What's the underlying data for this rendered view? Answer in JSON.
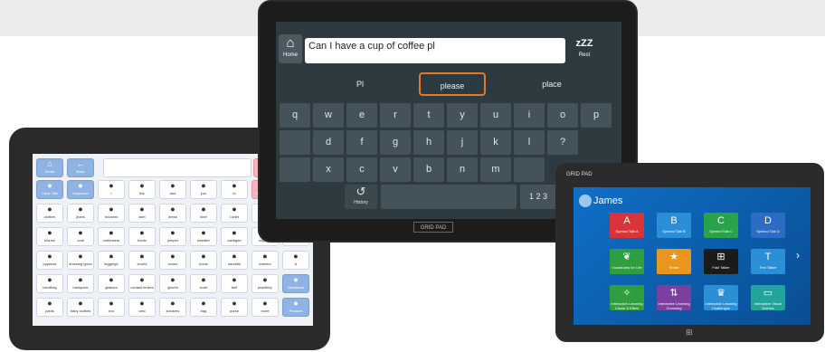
{
  "center": {
    "home_label": "Home",
    "message_text": "Can I have a cup of coffee pl",
    "rest_icon": "zZZ",
    "rest_label": "Rest",
    "predictions": [
      "Pl",
      "please",
      "place"
    ],
    "selected_prediction_index": 1,
    "keys_row1": [
      "q",
      "w",
      "e",
      "r",
      "t",
      "y",
      "u",
      "i",
      "o",
      "p"
    ],
    "keys_row2": [
      "",
      "d",
      "f",
      "g",
      "h",
      "j",
      "k",
      "l",
      "?"
    ],
    "keys_row3": [
      "",
      "x",
      "c",
      "v",
      "b",
      "n",
      "m",
      ""
    ],
    "bottom_history_label": "History",
    "bottom_numbers": "1 2 3",
    "brand": "GRID PAD",
    "colors": {
      "accent": "#e07a2a"
    }
  },
  "left": {
    "top_buttons": [
      {
        "label": "Home",
        "icon": "home-icon",
        "color": "blue"
      },
      {
        "label": "Back",
        "icon": "back-icon",
        "color": "blue"
      }
    ],
    "right_buttons": [
      {
        "label": "Speak",
        "icon": "speak-icon",
        "color": "pink"
      },
      {
        "label": "Clear",
        "icon": "clear-icon",
        "color": "pink"
      }
    ],
    "grid": [
      [
        "Clear Talk",
        "Keyboard",
        "I",
        "the",
        "and",
        "you",
        "to",
        "Next Word",
        "Quiet"
      ],
      [
        "clothes",
        "jeans",
        "trousers",
        "skirt",
        "dress",
        "shirt",
        "t-shirt",
        "top",
        "Next"
      ],
      [
        "blouse",
        "coat",
        "underwear",
        "boots",
        "jumper",
        "sweater",
        "cardigan",
        "slippers",
        "?"
      ],
      [
        "pyjamas",
        "dressing gown",
        "leggings",
        "shorts",
        "shoes",
        "boots",
        "sandals",
        "trainers",
        "&"
      ],
      [
        "handbag",
        "backpack",
        "glasses",
        "contact lenses",
        "gloves",
        "scarf",
        "belt",
        "jewellery",
        "Questions"
      ],
      [
        "pants",
        "baby clothes",
        "bra",
        "vest",
        "knickers",
        "bag",
        "purse",
        "more",
        "Phrases"
      ]
    ]
  },
  "right": {
    "brand": "GRID PAD",
    "user_name": "James",
    "tiles_row1": [
      {
        "label": "Symbol Talk A",
        "icon": "A",
        "color": "#d9343a"
      },
      {
        "label": "Symbol Talk B",
        "icon": "B",
        "color": "#2b8fd8"
      },
      {
        "label": "Symbol Talk C",
        "icon": "C",
        "color": "#29a34a"
      },
      {
        "label": "Symbol Talk D",
        "icon": "D",
        "color": "#2b6cc4"
      }
    ],
    "tiles_row2": [
      {
        "label": "Vocabulary for Life",
        "icon": "leaf-icon",
        "color": "#2e9e3e"
      },
      {
        "label": "Smart",
        "icon": "star-icon",
        "color": "#e8961e"
      },
      {
        "label": "Fast Talker",
        "icon": "windows-icon",
        "color": "#1b1b1b"
      },
      {
        "label": "Text Talker",
        "icon": "T",
        "color": "#2b8fd8"
      }
    ],
    "tiles_row3": [
      {
        "label": "Interactive Learning Cause & Effect",
        "icon": "wand-icon",
        "color": "#2e9e3e"
      },
      {
        "label": "Interactive Learning Choosing",
        "icon": "arrows-icon",
        "color": "#7b3fa0"
      },
      {
        "label": "Interactive Learning Challenges",
        "icon": "trophy-icon",
        "color": "#2b8fd8"
      },
      {
        "label": "Interactive Visual Scenes",
        "icon": "screen-icon",
        "color": "#21a59a"
      }
    ]
  }
}
